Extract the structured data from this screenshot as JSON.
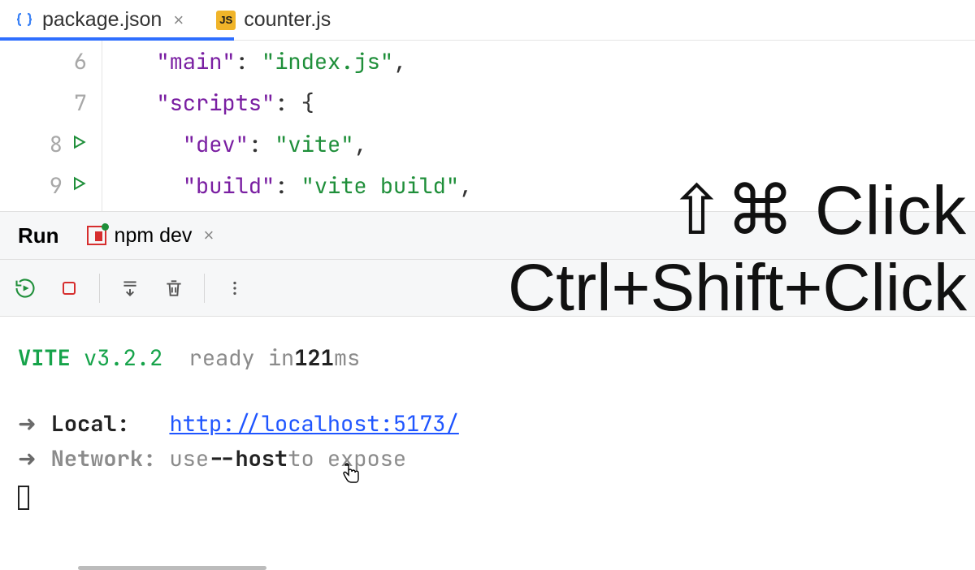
{
  "editor": {
    "tabs": [
      {
        "label": "package.json",
        "icon": "json"
      },
      {
        "label": "counter.js",
        "icon": "js"
      }
    ],
    "gutter": [
      {
        "n": "6",
        "run": false
      },
      {
        "n": "7",
        "run": false
      },
      {
        "n": "8",
        "run": true
      },
      {
        "n": "9",
        "run": true
      }
    ],
    "code": {
      "l6": {
        "indent": "  ",
        "key": "\"main\"",
        "colon": ": ",
        "val": "\"index.js\"",
        "tail": ","
      },
      "l7": {
        "indent": "  ",
        "key": "\"scripts\"",
        "colon": ": ",
        "brace": "{"
      },
      "l8": {
        "indent": "    ",
        "key": "\"dev\"",
        "colon": ": ",
        "val": "\"vite\"",
        "tail": ","
      },
      "l9": {
        "indent": "    ",
        "key": "\"build\"",
        "colon": ": ",
        "val": "\"vite build\"",
        "tail": ","
      }
    }
  },
  "run_panel": {
    "label": "Run",
    "tab": {
      "label": "npm dev"
    }
  },
  "terminal": {
    "banner": {
      "name": "VITE",
      "version": "v3.2.2",
      "ready_prefix": "ready in ",
      "ready_ms": "121",
      "ready_suffix": " ms"
    },
    "local": {
      "label": "Local:",
      "url": "http://localhost:5173/"
    },
    "network": {
      "label": "Network:",
      "prefix": "use ",
      "flag": "--host",
      "suffix": " to expose"
    }
  },
  "overlay": {
    "line1": "⇧⌘ Click",
    "line2": "Ctrl+Shift+Click"
  }
}
